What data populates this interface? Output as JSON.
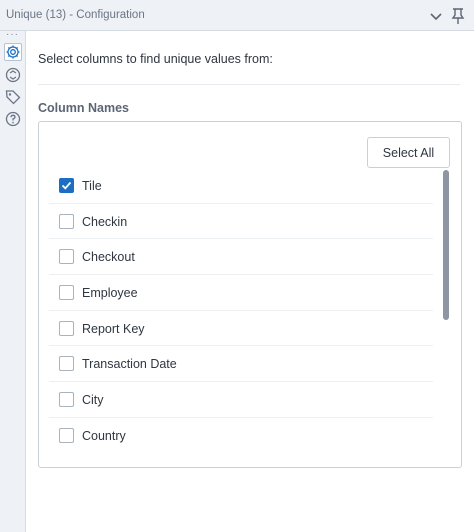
{
  "window": {
    "title": "Unique (13) - Configuration"
  },
  "sidebar": {
    "items": [
      {
        "icon": "gear-icon",
        "active": true
      },
      {
        "icon": "connection-icon",
        "active": false
      },
      {
        "icon": "tag-icon",
        "active": false
      },
      {
        "icon": "help-icon",
        "active": false
      }
    ]
  },
  "config": {
    "instruction": "Select columns to find unique values from:",
    "section_label": "Column Names",
    "select_all_label": "Select All",
    "columns": [
      {
        "label": "Tile",
        "checked": true
      },
      {
        "label": "Checkin",
        "checked": false
      },
      {
        "label": "Checkout",
        "checked": false
      },
      {
        "label": "Employee",
        "checked": false
      },
      {
        "label": "Report Key",
        "checked": false
      },
      {
        "label": "Transaction Date",
        "checked": false
      },
      {
        "label": "City",
        "checked": false
      },
      {
        "label": "Country",
        "checked": false
      }
    ]
  },
  "colors": {
    "accent": "#1b6ec2",
    "chrome": "#eef1f5"
  }
}
